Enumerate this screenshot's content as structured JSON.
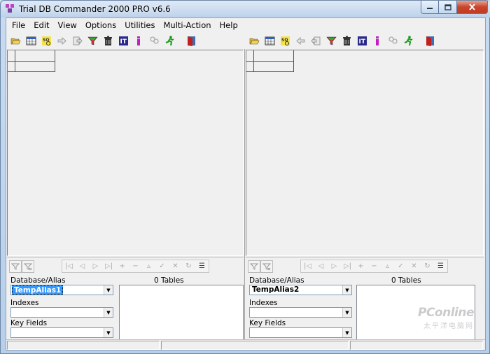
{
  "window": {
    "title": "Trial DB Commander 2000 PRO v6.6"
  },
  "menu": [
    "File",
    "Edit",
    "View",
    "Options",
    "Utilities",
    "Multi-Action",
    "Help"
  ],
  "left_panel": {
    "database_label": "Database/Alias",
    "database_value": "TempAlias1",
    "indexes_label": "Indexes",
    "key_fields_label": "Key Fields",
    "tables_count": "0 Tables"
  },
  "right_panel": {
    "database_label": "Database/Alias",
    "database_value": "TempAlias2",
    "indexes_label": "Indexes",
    "key_fields_label": "Key Fields",
    "tables_count": "0 Tables"
  },
  "watermark": {
    "main": "PConline",
    "sub": "太平洋电脑网"
  },
  "colors": {
    "selection": "#3399ff",
    "client_bg": "#f0f0f0",
    "close_btn": "#c8452c"
  }
}
